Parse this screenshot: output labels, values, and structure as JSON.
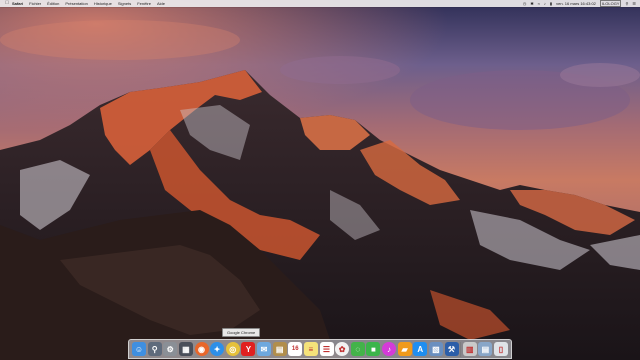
{
  "menubar": {
    "apple_icon": "apple-logo-icon",
    "app_name": "Safari",
    "items": [
      "Fichier",
      "Édition",
      "Présentation",
      "Historique",
      "Signets",
      "Fenêtre",
      "Aide"
    ],
    "status_icons": [
      "time-machine-icon",
      "bluetooth-icon",
      "wifi-icon",
      "volume-icon",
      "battery-icon"
    ],
    "clock": "ven. 16 mars  16:43:02",
    "user": "ILOLOGY"
  },
  "tooltip": {
    "text": "Google Chrome"
  },
  "dock": {
    "apps": [
      {
        "name": "finder",
        "icon": "finder-icon",
        "color": "#3f8fe0"
      },
      {
        "name": "launchpad",
        "icon": "rocket-icon",
        "color": "#5f6b7c"
      },
      {
        "name": "system-preferences",
        "icon": "gear-icon",
        "color": "#8a8f96"
      },
      {
        "name": "mission-control",
        "icon": "mission-control-icon",
        "color": "#4a4f5a"
      },
      {
        "name": "firefox",
        "icon": "firefox-icon",
        "color": "#e8662a"
      },
      {
        "name": "safari",
        "icon": "compass-icon",
        "color": "#2e8fe8"
      },
      {
        "name": "google-chrome",
        "icon": "chrome-icon",
        "color": "#e6c13b"
      },
      {
        "name": "yandex",
        "icon": "yandex-icon",
        "color": "#e02020"
      },
      {
        "name": "mail",
        "icon": "stamp-icon",
        "color": "#6ea8de"
      },
      {
        "name": "notefile",
        "icon": "notebook-icon",
        "color": "#b18e4c"
      },
      {
        "name": "calendar",
        "icon": "calendar-icon",
        "color": "#ffffff"
      },
      {
        "name": "notes",
        "icon": "notes-icon",
        "color": "#f5e27a"
      },
      {
        "name": "reminders",
        "icon": "list-icon",
        "color": "#ffffff"
      },
      {
        "name": "photos",
        "icon": "photos-icon",
        "color": "#f2f2f2"
      },
      {
        "name": "messages",
        "icon": "chat-bubble-icon",
        "color": "#43b34a"
      },
      {
        "name": "facetime",
        "icon": "video-camera-icon",
        "color": "#3bb54a"
      },
      {
        "name": "itunes",
        "icon": "music-note-icon",
        "color": "#d43bd8"
      },
      {
        "name": "ibooks",
        "icon": "book-icon",
        "color": "#f09a1b"
      },
      {
        "name": "app-store",
        "icon": "app-store-icon",
        "color": "#1f8ef0"
      },
      {
        "name": "preview",
        "icon": "preview-icon",
        "color": "#6a8fbf"
      },
      {
        "name": "xcode",
        "icon": "xcode-icon",
        "color": "#2c5ea8"
      }
    ],
    "trailing": [
      {
        "name": "downloads",
        "icon": "downloads-stack-icon",
        "color": "#c9c9c9"
      },
      {
        "name": "documents",
        "icon": "folder-stack-icon",
        "color": "#88a6c8"
      },
      {
        "name": "trash",
        "icon": "trash-icon",
        "color": "#dfe3e8"
      }
    ]
  }
}
